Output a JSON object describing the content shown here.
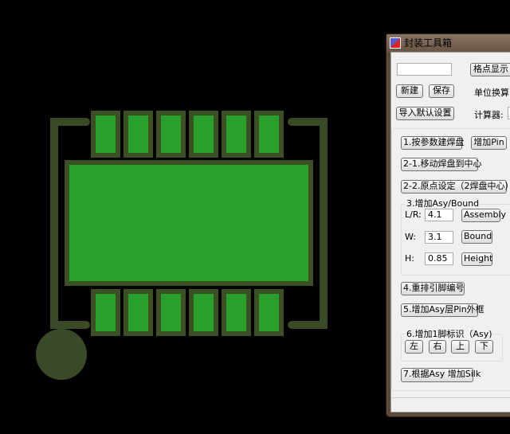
{
  "window": {
    "title": "封装工具箱",
    "icon": "app-icon"
  },
  "toolbar": {
    "input_value": "",
    "grid_button": "格点显示",
    "new_button": "新建",
    "save_button": "保存",
    "unit_label": "单位换算:",
    "import_button": "导入默认设置",
    "calc_label": "计算器:"
  },
  "steps": {
    "s1": "1.按参数建焊盘",
    "add_pin": "增加Pin",
    "s21": "2-1.移动焊盘到中心",
    "s22": "2-2.原点设定（2焊盘中心）",
    "s3": {
      "title": "3.增加Asy/Bound",
      "lr_label": "L/R:",
      "lr_value": "4.1",
      "assembly": "Assembly",
      "w_label": "W:",
      "w_value": "3.1",
      "bound": "Bound",
      "h_label": "H:",
      "h_value": "0.85",
      "height": "Height"
    },
    "s4": "4.重排引脚编号",
    "s5": "5.增加Asy层Pin外框",
    "s6": {
      "title": "6.增加1脚标识（Asy)",
      "left": "左",
      "right": "右",
      "up": "上",
      "down": "下"
    },
    "s7": "7.根据Asy 增加Silk"
  },
  "pcb": {
    "pad_count_per_row": 6,
    "pad_fill": "#2aa12a",
    "pad_outline": "#3d4f25",
    "silk": "#3a4a26",
    "pin1_marker": "#3a4a28"
  }
}
